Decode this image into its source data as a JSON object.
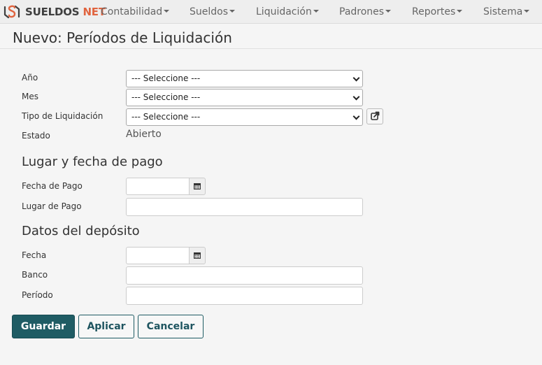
{
  "app": {
    "brand_part1": "SUELDOS",
    "brand_part2": "NET",
    "brand_color_dark": "#3f3f3f",
    "brand_color_accent": "#e0643f"
  },
  "nav": {
    "items": [
      {
        "label": "Contabilidad"
      },
      {
        "label": "Sueldos"
      },
      {
        "label": "Liquidación"
      },
      {
        "label": "Padrones"
      },
      {
        "label": "Reportes"
      },
      {
        "label": "Sistema"
      }
    ]
  },
  "page": {
    "title": "Nuevo: Períodos de Liquidación"
  },
  "form": {
    "anio": {
      "label": "Año",
      "value": "--- Seleccione ---"
    },
    "mes": {
      "label": "Mes",
      "value": "--- Seleccione ---"
    },
    "tipo": {
      "label": "Tipo de Liquidación",
      "value": "--- Seleccione ---",
      "external_icon": "external-link-icon"
    },
    "estado": {
      "label": "Estado",
      "value": "Abierto"
    }
  },
  "pago": {
    "heading": "Lugar y fecha de pago",
    "fecha": {
      "label": "Fecha de Pago",
      "value": "",
      "icon": "calendar-icon"
    },
    "lugar": {
      "label": "Lugar de Pago",
      "value": ""
    }
  },
  "deposito": {
    "heading": "Datos del depósito",
    "fecha": {
      "label": "Fecha",
      "value": "",
      "icon": "calendar-icon"
    },
    "banco": {
      "label": "Banco",
      "value": ""
    },
    "periodo": {
      "label": "Período",
      "value": ""
    }
  },
  "actions": {
    "save": "Guardar",
    "apply": "Aplicar",
    "cancel": "Cancelar",
    "primary_color": "#1f5c64"
  }
}
